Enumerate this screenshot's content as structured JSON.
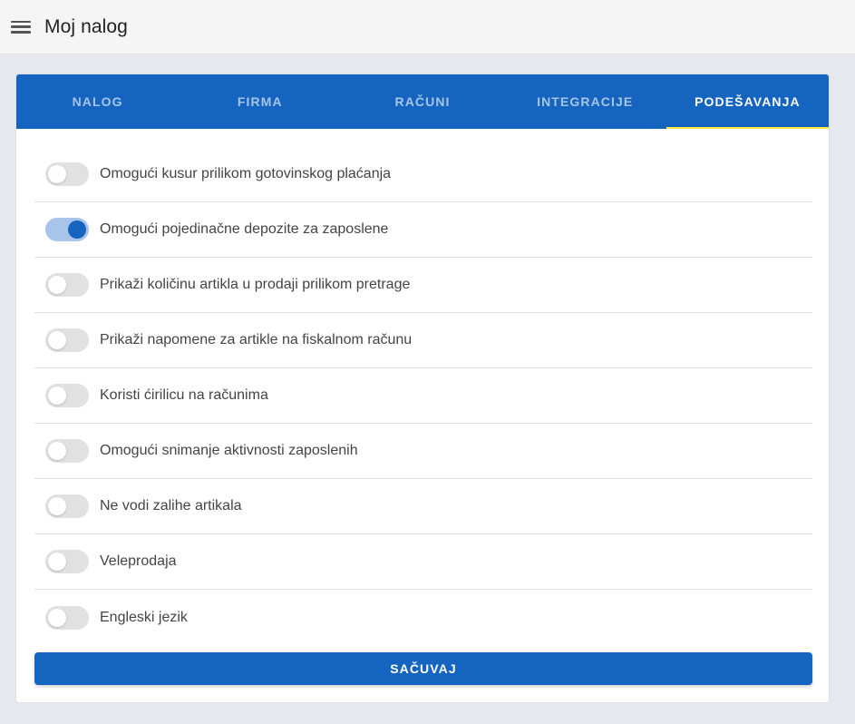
{
  "header": {
    "menu_icon": "hamburger-menu-icon",
    "title": "Moj nalog"
  },
  "tabs": [
    {
      "label": "NALOG",
      "active": false
    },
    {
      "label": "FIRMA",
      "active": false
    },
    {
      "label": "RAČUNI",
      "active": false
    },
    {
      "label": "INTEGRACIJE",
      "active": false
    },
    {
      "label": "PODEŠAVANJA",
      "active": true
    }
  ],
  "settings": [
    {
      "label": "Omogući kusur prilikom gotovinskog plaćanja",
      "enabled": false
    },
    {
      "label": "Omogući pojedinačne depozite za zaposlene",
      "enabled": true
    },
    {
      "label": "Prikaži količinu artikla u prodaji prilikom pretrage",
      "enabled": false
    },
    {
      "label": "Prikaži napomene za artikle na fiskalnom računu",
      "enabled": false
    },
    {
      "label": "Koristi ćirilicu na računima",
      "enabled": false
    },
    {
      "label": "Omogući snimanje aktivnosti zaposlenih",
      "enabled": false
    },
    {
      "label": "Ne vodi zalihe artikala",
      "enabled": false
    },
    {
      "label": "Veleprodaja",
      "enabled": false
    },
    {
      "label": "Engleski jezik",
      "enabled": false
    }
  ],
  "save_label": "SAČUVAJ",
  "colors": {
    "primary": "#1565c0",
    "tab_indicator": "#ffeb3b",
    "toggle_on_track": "#a9c4ea",
    "toggle_off_track": "#e1e1e1"
  }
}
